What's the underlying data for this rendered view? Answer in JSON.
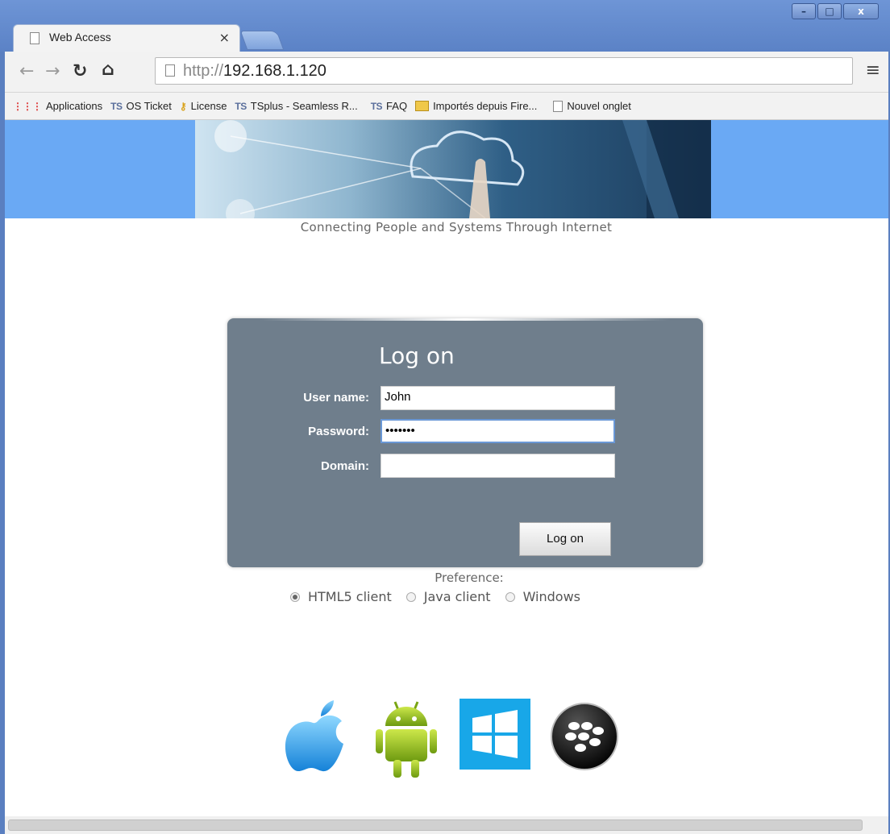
{
  "browser": {
    "tab_title": "Web Access",
    "tab_close": "×",
    "window_controls": {
      "minimize": "–",
      "maximize": "□",
      "close": "x"
    },
    "url_prefix": "http://",
    "url_host": "192.168.1.120",
    "menu_icon": "≡"
  },
  "bookmarks": [
    {
      "label": "Applications",
      "icon": "apps-grid-icon"
    },
    {
      "label": "OS Ticket",
      "icon": "tsplus-icon"
    },
    {
      "label": "License",
      "icon": "key-icon"
    },
    {
      "label": "TSplus - Seamless R...",
      "icon": "tsplus-icon"
    },
    {
      "label": "FAQ",
      "icon": "tsplus-icon"
    },
    {
      "label": "Importés depuis Fire...",
      "icon": "folder-icon"
    },
    {
      "label": "Nouvel onglet",
      "icon": "page-icon"
    }
  ],
  "bookmark_icon_text": {
    "ts": "TS"
  },
  "page": {
    "tagline": "Connecting People and Systems Through Internet"
  },
  "login": {
    "title": "Log on",
    "username_label": "User name:",
    "username_value": "John",
    "password_label": "Password:",
    "password_value": "•••••••",
    "domain_label": "Domain:",
    "domain_value": "",
    "button_label": "Log on"
  },
  "preference": {
    "label": "Preference:",
    "options": [
      {
        "label": "HTML5 client",
        "selected": true
      },
      {
        "label": "Java client",
        "selected": false
      },
      {
        "label": "Windows",
        "selected": false
      }
    ]
  },
  "platform_icons": [
    "apple-icon",
    "android-icon",
    "windows-icon",
    "blackberry-icon"
  ],
  "colors": {
    "banner_band": "#6aa9f4",
    "login_panel": "#6f7e8c",
    "window_frame": "#5a7fc0"
  }
}
